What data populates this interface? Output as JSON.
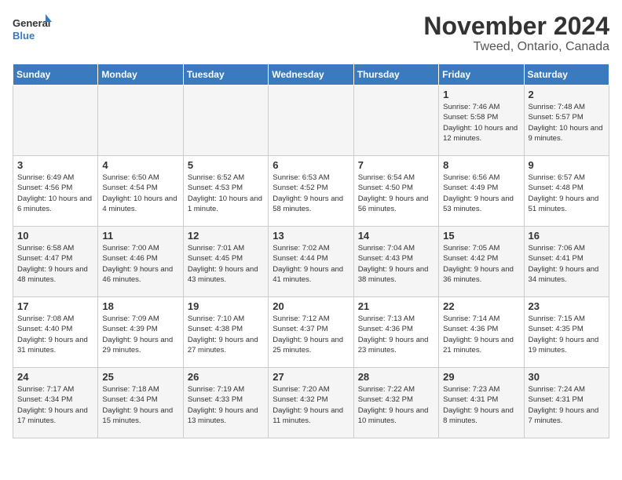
{
  "logo": {
    "line1": "General",
    "line2": "Blue"
  },
  "title": "November 2024",
  "location": "Tweed, Ontario, Canada",
  "days_header": [
    "Sunday",
    "Monday",
    "Tuesday",
    "Wednesday",
    "Thursday",
    "Friday",
    "Saturday"
  ],
  "weeks": [
    [
      {
        "day": "",
        "info": ""
      },
      {
        "day": "",
        "info": ""
      },
      {
        "day": "",
        "info": ""
      },
      {
        "day": "",
        "info": ""
      },
      {
        "day": "",
        "info": ""
      },
      {
        "day": "1",
        "info": "Sunrise: 7:46 AM\nSunset: 5:58 PM\nDaylight: 10 hours and 12 minutes."
      },
      {
        "day": "2",
        "info": "Sunrise: 7:48 AM\nSunset: 5:57 PM\nDaylight: 10 hours and 9 minutes."
      }
    ],
    [
      {
        "day": "3",
        "info": "Sunrise: 6:49 AM\nSunset: 4:56 PM\nDaylight: 10 hours and 6 minutes."
      },
      {
        "day": "4",
        "info": "Sunrise: 6:50 AM\nSunset: 4:54 PM\nDaylight: 10 hours and 4 minutes."
      },
      {
        "day": "5",
        "info": "Sunrise: 6:52 AM\nSunset: 4:53 PM\nDaylight: 10 hours and 1 minute."
      },
      {
        "day": "6",
        "info": "Sunrise: 6:53 AM\nSunset: 4:52 PM\nDaylight: 9 hours and 58 minutes."
      },
      {
        "day": "7",
        "info": "Sunrise: 6:54 AM\nSunset: 4:50 PM\nDaylight: 9 hours and 56 minutes."
      },
      {
        "day": "8",
        "info": "Sunrise: 6:56 AM\nSunset: 4:49 PM\nDaylight: 9 hours and 53 minutes."
      },
      {
        "day": "9",
        "info": "Sunrise: 6:57 AM\nSunset: 4:48 PM\nDaylight: 9 hours and 51 minutes."
      }
    ],
    [
      {
        "day": "10",
        "info": "Sunrise: 6:58 AM\nSunset: 4:47 PM\nDaylight: 9 hours and 48 minutes."
      },
      {
        "day": "11",
        "info": "Sunrise: 7:00 AM\nSunset: 4:46 PM\nDaylight: 9 hours and 46 minutes."
      },
      {
        "day": "12",
        "info": "Sunrise: 7:01 AM\nSunset: 4:45 PM\nDaylight: 9 hours and 43 minutes."
      },
      {
        "day": "13",
        "info": "Sunrise: 7:02 AM\nSunset: 4:44 PM\nDaylight: 9 hours and 41 minutes."
      },
      {
        "day": "14",
        "info": "Sunrise: 7:04 AM\nSunset: 4:43 PM\nDaylight: 9 hours and 38 minutes."
      },
      {
        "day": "15",
        "info": "Sunrise: 7:05 AM\nSunset: 4:42 PM\nDaylight: 9 hours and 36 minutes."
      },
      {
        "day": "16",
        "info": "Sunrise: 7:06 AM\nSunset: 4:41 PM\nDaylight: 9 hours and 34 minutes."
      }
    ],
    [
      {
        "day": "17",
        "info": "Sunrise: 7:08 AM\nSunset: 4:40 PM\nDaylight: 9 hours and 31 minutes."
      },
      {
        "day": "18",
        "info": "Sunrise: 7:09 AM\nSunset: 4:39 PM\nDaylight: 9 hours and 29 minutes."
      },
      {
        "day": "19",
        "info": "Sunrise: 7:10 AM\nSunset: 4:38 PM\nDaylight: 9 hours and 27 minutes."
      },
      {
        "day": "20",
        "info": "Sunrise: 7:12 AM\nSunset: 4:37 PM\nDaylight: 9 hours and 25 minutes."
      },
      {
        "day": "21",
        "info": "Sunrise: 7:13 AM\nSunset: 4:36 PM\nDaylight: 9 hours and 23 minutes."
      },
      {
        "day": "22",
        "info": "Sunrise: 7:14 AM\nSunset: 4:36 PM\nDaylight: 9 hours and 21 minutes."
      },
      {
        "day": "23",
        "info": "Sunrise: 7:15 AM\nSunset: 4:35 PM\nDaylight: 9 hours and 19 minutes."
      }
    ],
    [
      {
        "day": "24",
        "info": "Sunrise: 7:17 AM\nSunset: 4:34 PM\nDaylight: 9 hours and 17 minutes."
      },
      {
        "day": "25",
        "info": "Sunrise: 7:18 AM\nSunset: 4:34 PM\nDaylight: 9 hours and 15 minutes."
      },
      {
        "day": "26",
        "info": "Sunrise: 7:19 AM\nSunset: 4:33 PM\nDaylight: 9 hours and 13 minutes."
      },
      {
        "day": "27",
        "info": "Sunrise: 7:20 AM\nSunset: 4:32 PM\nDaylight: 9 hours and 11 minutes."
      },
      {
        "day": "28",
        "info": "Sunrise: 7:22 AM\nSunset: 4:32 PM\nDaylight: 9 hours and 10 minutes."
      },
      {
        "day": "29",
        "info": "Sunrise: 7:23 AM\nSunset: 4:31 PM\nDaylight: 9 hours and 8 minutes."
      },
      {
        "day": "30",
        "info": "Sunrise: 7:24 AM\nSunset: 4:31 PM\nDaylight: 9 hours and 7 minutes."
      }
    ]
  ]
}
